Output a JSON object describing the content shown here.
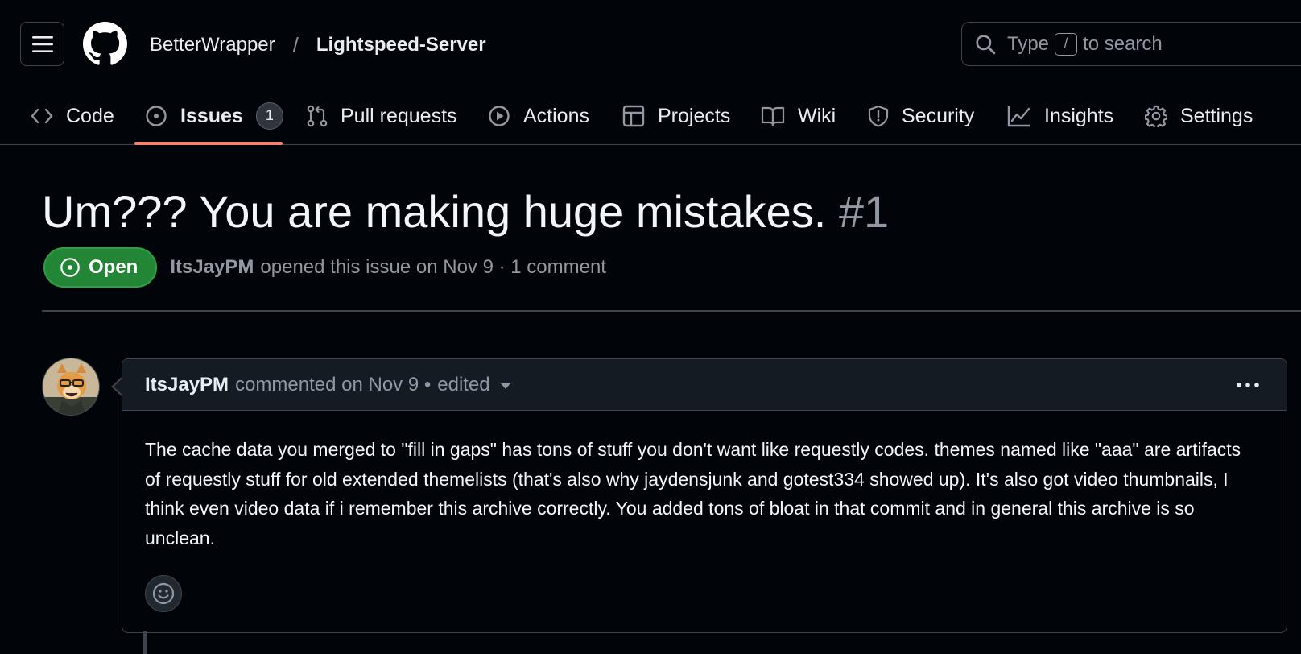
{
  "header": {
    "owner": "BetterWrapper",
    "separator": "/",
    "repo": "Lightspeed-Server",
    "search": {
      "prefix": "Type",
      "shortcut": "/",
      "suffix": "to search"
    }
  },
  "nav": {
    "tabs": [
      {
        "label": "Code",
        "icon": "code-icon"
      },
      {
        "label": "Issues",
        "icon": "issue-opened-icon",
        "count": "1",
        "active": true
      },
      {
        "label": "Pull requests",
        "icon": "git-pull-request-icon"
      },
      {
        "label": "Actions",
        "icon": "play-icon"
      },
      {
        "label": "Projects",
        "icon": "table-icon"
      },
      {
        "label": "Wiki",
        "icon": "book-icon"
      },
      {
        "label": "Security",
        "icon": "shield-icon"
      },
      {
        "label": "Insights",
        "icon": "graph-icon"
      },
      {
        "label": "Settings",
        "icon": "gear-icon"
      }
    ],
    "accent_color": "#f78166"
  },
  "issue": {
    "title": "Um??? You are making huge mistakes.",
    "number": "#1",
    "state": "Open",
    "state_color": "#238636",
    "author": "ItsJayPM",
    "meta_text": "opened this issue on Nov 9 · 1 comment"
  },
  "comment": {
    "author": "ItsJayPM",
    "action_text": "commented on Nov 9 •",
    "edited": "edited",
    "body": "The cache data you merged to \"fill in gaps\" has tons of stuff you don't want like requestly codes. themes named like \"aaa\" are artifacts of requestly stuff for old extended themelists (that's also why jaydensjunk and gotest334 showed up). It's also got video thumbnails, I think even video data if i remember this archive correctly. You added tons of bloat in that commit and in general this archive is so unclean."
  }
}
